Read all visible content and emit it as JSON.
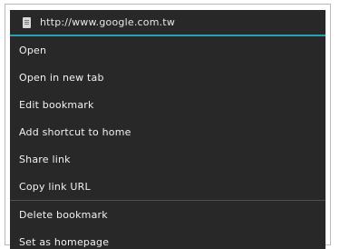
{
  "header": {
    "url": "http://www.google.com.tw",
    "icon": "page-icon",
    "accent_color": "#2a9fb6"
  },
  "menu": {
    "items": [
      {
        "label": "Open"
      },
      {
        "label": "Open in new tab"
      },
      {
        "label": "Edit bookmark"
      },
      {
        "label": "Add shortcut to home"
      },
      {
        "label": "Share link"
      },
      {
        "label": "Copy link URL"
      },
      {
        "label": "Delete bookmark"
      },
      {
        "label": "Set as homepage"
      }
    ]
  },
  "colors": {
    "menu_background": "#282828",
    "text": "#f2f2f2"
  }
}
